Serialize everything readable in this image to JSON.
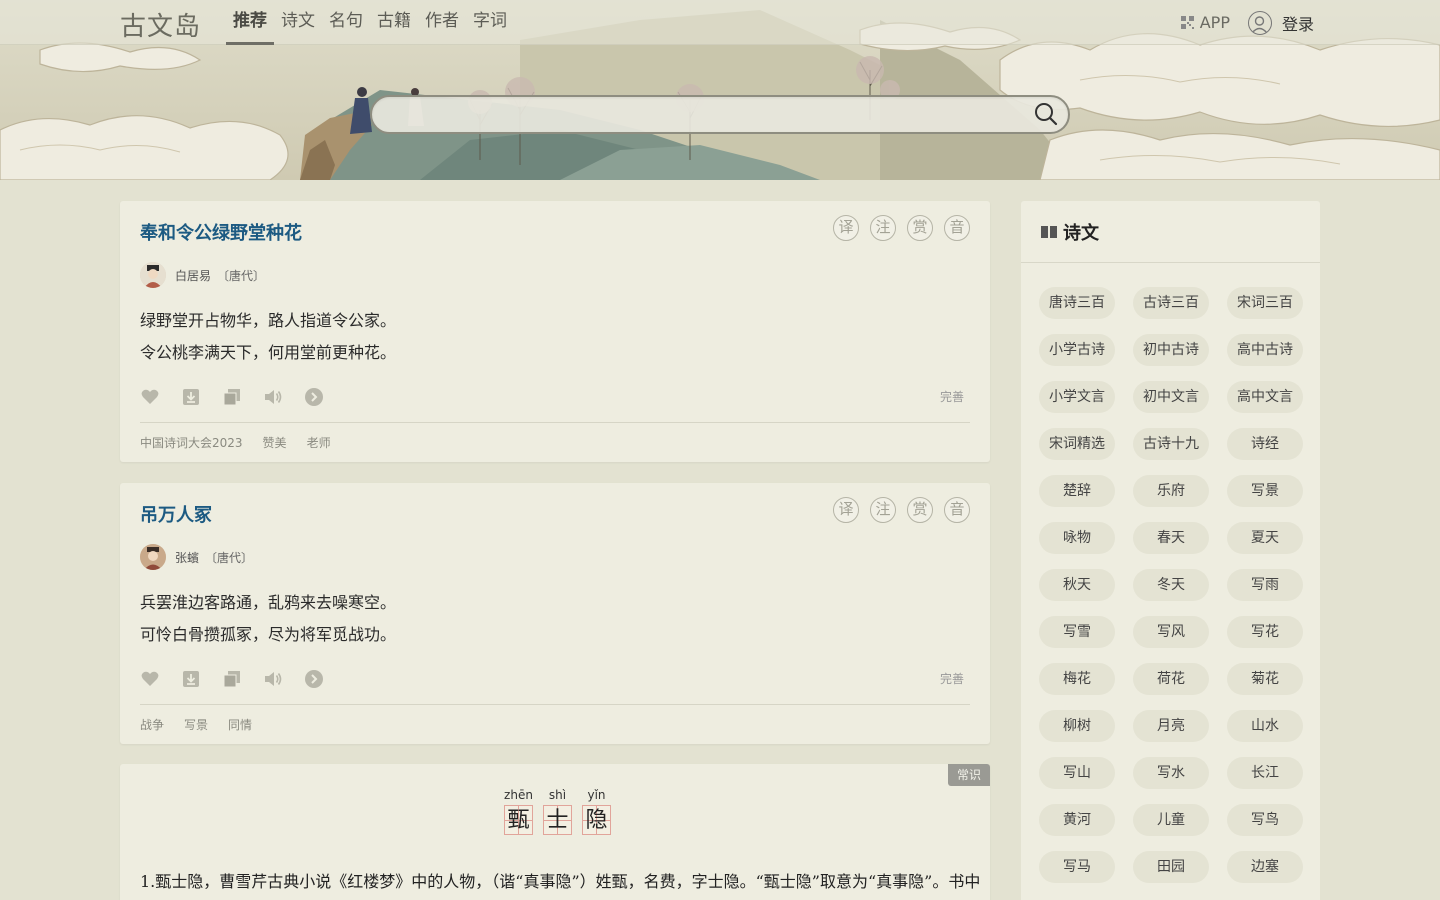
{
  "header": {
    "logo": "古文岛",
    "nav": [
      "推荐",
      "诗文",
      "名句",
      "古籍",
      "作者",
      "字词"
    ],
    "active_nav": "推荐",
    "app_label": "APP",
    "login_label": "登录"
  },
  "search": {
    "value": "",
    "placeholder": ""
  },
  "poems": [
    {
      "title": "奉和令公绿野堂种花",
      "author": "白居易",
      "dynasty": "〔唐代〕",
      "lines": [
        "绿野堂开占物华，路人指道令公家。",
        "令公桃李满天下，何用堂前更种花。"
      ],
      "seals": [
        "译",
        "注",
        "赏",
        "音"
      ],
      "perfect_label": "完善",
      "tags": [
        "中国诗词大会2023",
        "赞美",
        "老师"
      ]
    },
    {
      "title": "吊万人冢",
      "author": "张蠙",
      "dynasty": "〔唐代〕",
      "lines": [
        "兵罢淮边客路通，乱鸦来去噪寒空。",
        "可怜白骨攒孤冢，尽为将军觅战功。"
      ],
      "seals": [
        "译",
        "注",
        "赏",
        "音"
      ],
      "perfect_label": "完善",
      "tags": [
        "战争",
        "写景",
        "同情"
      ]
    }
  ],
  "knowledge": {
    "badge": "常识",
    "pinyin": [
      "zhēn",
      "shì",
      "yǐn"
    ],
    "chars": [
      "甄",
      "士",
      "隐"
    ],
    "text": "1.甄士隐，曹雪芹古典小说《红楼梦》中的人物，（谐“真事隐”）姓甄，名费，字士隐。“甄士隐”取意为“真事隐”。书中"
  },
  "sidebar": {
    "title": "诗文",
    "chips": [
      "唐诗三百",
      "古诗三百",
      "宋词三百",
      "小学古诗",
      "初中古诗",
      "高中古诗",
      "小学文言",
      "初中文言",
      "高中文言",
      "宋词精选",
      "古诗十九",
      "诗经",
      "楚辞",
      "乐府",
      "写景",
      "咏物",
      "春天",
      "夏天",
      "秋天",
      "冬天",
      "写雨",
      "写雪",
      "写风",
      "写花",
      "梅花",
      "荷花",
      "菊花",
      "柳树",
      "月亮",
      "山水",
      "写山",
      "写水",
      "长江",
      "黄河",
      "儿童",
      "写鸟",
      "写马",
      "田园",
      "边塞"
    ]
  },
  "colors": {
    "background": "#e3e2d1",
    "card": "#eeede0",
    "title_link": "#1c5a82",
    "badge": "#9a9a94"
  },
  "icons": [
    "qr-code-icon",
    "user-icon",
    "search-icon",
    "heart-icon",
    "download-icon",
    "copy-icon",
    "audio-icon",
    "arrow-right-icon",
    "book-icon"
  ]
}
